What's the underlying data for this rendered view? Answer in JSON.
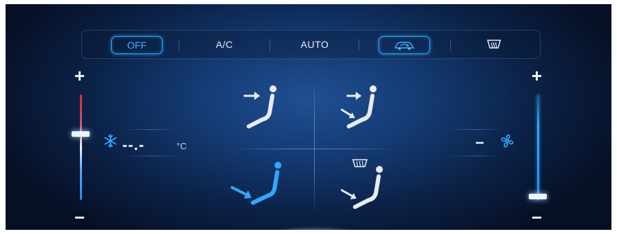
{
  "topbar": {
    "off_label": "OFF",
    "ac_label": "A/C",
    "auto_label": "AUTO",
    "recirculation_icon": "car-recirculation-icon",
    "rear_defrost_icon": "rear-defrost-icon",
    "active_items": [
      "OFF",
      "recirculation"
    ]
  },
  "left_panel": {
    "plus": "+",
    "minus": "−",
    "snowflake_icon": "snowflake-icon",
    "temperature": "--.-",
    "unit": "°C",
    "slider_level": 0.64
  },
  "right_panel": {
    "plus": "+",
    "minus": "−",
    "fan_icon": "fan-icon",
    "fan_speed": "−",
    "slider_level": 0.02
  },
  "modes": [
    {
      "name": "face",
      "icon": "face-airflow-icon",
      "active": false
    },
    {
      "name": "face-feet",
      "icon": "face-feet-airflow-icon",
      "active": false
    },
    {
      "name": "feet",
      "icon": "feet-airflow-icon",
      "active": true
    },
    {
      "name": "feet-defrost",
      "icon": "feet-defrost-airflow-icon",
      "active": false
    }
  ],
  "colors": {
    "accent": "#2fa8ff",
    "hot": "#e0263a",
    "cold": "#1e8cff",
    "inactive": "#e6ebf4"
  }
}
